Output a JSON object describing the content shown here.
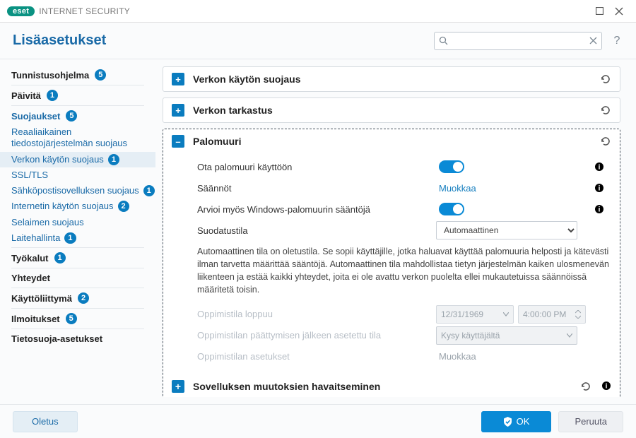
{
  "titlebar": {
    "brand_badge": "eset",
    "brand_name": "INTERNET SECURITY"
  },
  "header": {
    "title": "Lisäasetukset",
    "search_placeholder": ""
  },
  "sidebar": {
    "items": [
      {
        "label": "Tunnistusohjelma",
        "count": "5",
        "bold": true
      },
      {
        "label": "Päivitä",
        "count": "1",
        "bold": true
      },
      {
        "label": "Suojaukset",
        "count": "5",
        "bold": true
      },
      {
        "label": "Reaaliaikainen tiedostojärjestelmän suojaus"
      },
      {
        "label": "Verkon käytön suojaus",
        "count": "1",
        "selected": true
      },
      {
        "label": "SSL/TLS"
      },
      {
        "label": "Sähköpostisovelluksen suojaus",
        "count": "1"
      },
      {
        "label": "Internetin käytön suojaus",
        "count": "2"
      },
      {
        "label": "Selaimen suojaus"
      },
      {
        "label": "Laitehallinta",
        "count": "1"
      },
      {
        "label": "Työkalut",
        "count": "1",
        "bold": true
      },
      {
        "label": "Yhteydet",
        "bold": true
      },
      {
        "label": "Käyttöliittymä",
        "count": "2",
        "bold": true
      },
      {
        "label": "Ilmoitukset",
        "count": "5",
        "bold": true
      },
      {
        "label": "Tietosuoja-asetukset",
        "bold": true
      }
    ]
  },
  "panels": {
    "p1": {
      "title": "Verkon käytön suojaus"
    },
    "p2": {
      "title": "Verkon tarkastus"
    },
    "p3": {
      "title": "Palomuuri",
      "r_enable": "Ota palomuuri käyttöön",
      "r_rules": "Säännöt",
      "r_rules_link": "Muokkaa",
      "r_winfw": "Arvioi myös Windows-palomuurin sääntöjä",
      "r_mode": "Suodatustila",
      "r_mode_val": "Automaattinen",
      "desc": "Automaattinen tila on oletustila. Se sopii käyttäjille, jotka haluavat käyttää palomuuria helposti ja kätevästi ilman tarvetta määrittää sääntöjä. Automaattinen tila mahdollistaa tietyn järjestelmän kaiken ulosmenevän liikenteen ja estää kaikki yhteydet, joita ei ole avattu verkon puolelta ellei mukautetuissa säännöissä määritetä toisin.",
      "r_learn_end": "Oppimistila loppuu",
      "r_learn_date": "12/31/1969",
      "r_learn_time": "4:00:00 PM",
      "r_after": "Oppimistilan päättymisen jälkeen asetettu tila",
      "r_after_val": "Kysy käyttäjältä",
      "r_learn_cfg": "Oppimistilan asetukset",
      "r_learn_cfg_link": "Muokkaa"
    },
    "p4": {
      "title": "Sovelluksen muutoksien havaitseminen"
    }
  },
  "footer": {
    "default": "Oletus",
    "ok": "OK",
    "cancel": "Peruuta"
  }
}
